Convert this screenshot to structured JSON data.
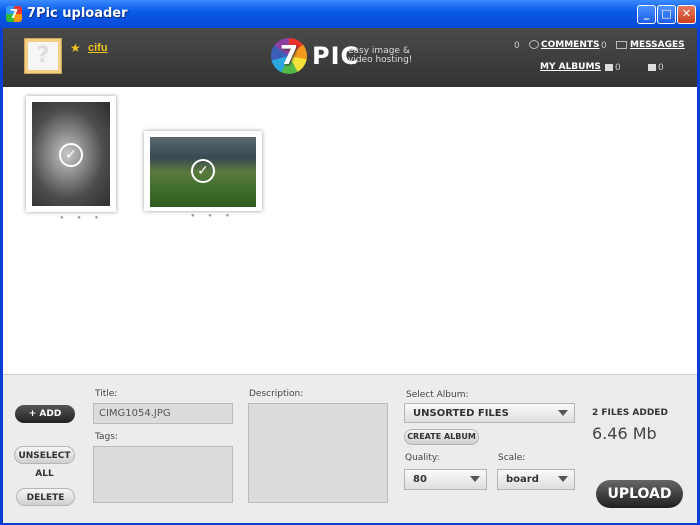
{
  "window": {
    "title": "7Pic uploader",
    "icon": "7",
    "buttons": [
      "_",
      "□",
      "✕"
    ]
  },
  "header": {
    "username": "cifu",
    "logo_mark": "7",
    "logo_text": "PIC",
    "tagline": "easy image & video hosting!",
    "comments": {
      "count": "0",
      "label": "COMMENTS"
    },
    "messages": {
      "count": "0",
      "label": "MESSAGES"
    },
    "my_albums": {
      "label": "MY ALBUMS",
      "count_a": "0",
      "count_b": "0"
    }
  },
  "thumbnails": [
    {
      "name": "dog-photo",
      "selected": true
    },
    {
      "name": "stadium-photo",
      "selected": true
    }
  ],
  "panel": {
    "add_label": "+ ADD",
    "unselect_all_label": "UNSELECT ALL",
    "delete_label": "DELETE",
    "title_label": "Title:",
    "title_value": "CIMG1054.JPG",
    "tags_label": "Tags:",
    "description_label": "Description:",
    "select_album_label": "Select Album:",
    "album_value": "UNSORTED FILES",
    "create_album_label": "CREATE ALBUM",
    "quality_label": "Quality:",
    "quality_value": "80",
    "scale_label": "Scale:",
    "scale_value": "board",
    "files_added": "2 FILES ADDED",
    "total_size": "6.46 Mb",
    "upload_label": "UPLOAD"
  }
}
